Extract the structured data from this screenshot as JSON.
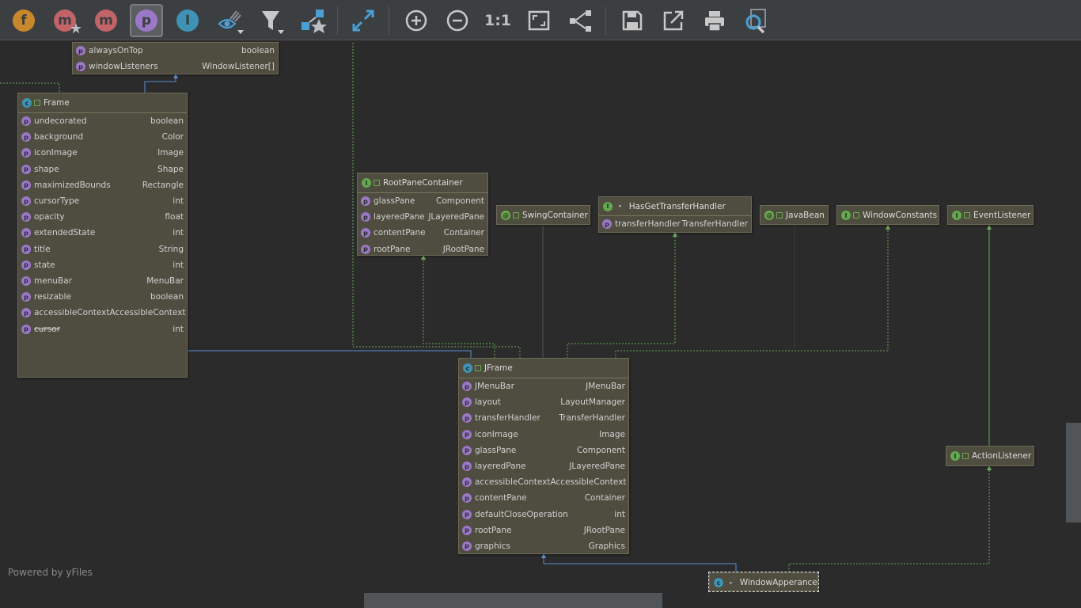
{
  "toolbar": {
    "buttons": [
      {
        "name": "fields-button",
        "glyph": "f",
        "color": "#c8872b",
        "active": false
      },
      {
        "name": "methods-starred-button",
        "glyph": "m",
        "color": "#c26368",
        "active": false,
        "star": true
      },
      {
        "name": "methods-button",
        "glyph": "m",
        "color": "#c26368",
        "active": false
      },
      {
        "name": "properties-button",
        "glyph": "p",
        "color": "#9a78c7",
        "active": true
      },
      {
        "name": "inner-classes-button",
        "glyph": "I",
        "color": "#3e93b5",
        "active": false
      }
    ],
    "zoom_actual_label": "1:1"
  },
  "watermark": "Powered by yFiles",
  "nodes": {
    "window_props": {
      "rows": [
        {
          "name": "alwaysOnTop",
          "type": "boolean"
        },
        {
          "name": "windowListeners",
          "type": "WindowListener[]"
        }
      ]
    },
    "frame": {
      "title": "Frame",
      "rows": [
        {
          "name": "undecorated",
          "type": "boolean"
        },
        {
          "name": "background",
          "type": "Color"
        },
        {
          "name": "iconImage",
          "type": "Image"
        },
        {
          "name": "shape",
          "type": "Shape"
        },
        {
          "name": "maximizedBounds",
          "type": "Rectangle"
        },
        {
          "name": "cursorType",
          "type": "int"
        },
        {
          "name": "opacity",
          "type": "float"
        },
        {
          "name": "extendedState",
          "type": "int"
        },
        {
          "name": "title",
          "type": "String"
        },
        {
          "name": "state",
          "type": "int"
        },
        {
          "name": "menuBar",
          "type": "MenuBar"
        },
        {
          "name": "resizable",
          "type": "boolean"
        },
        {
          "name": "accessibleContext",
          "type": "AccessibleContext"
        },
        {
          "name": "cursor",
          "type": "int"
        }
      ]
    },
    "root_pane_container": {
      "title": "RootPaneContainer",
      "rows": [
        {
          "name": "glassPane",
          "type": "Component"
        },
        {
          "name": "layeredPane",
          "type": "JLayeredPane"
        },
        {
          "name": "contentPane",
          "type": "Container"
        },
        {
          "name": "rootPane",
          "type": "JRootPane"
        }
      ]
    },
    "swing_container": {
      "title": "SwingContainer"
    },
    "has_get_transfer_handler": {
      "title": "HasGetTransferHandler",
      "rows": [
        {
          "name": "transferHandler",
          "type": "TransferHandler"
        }
      ]
    },
    "java_bean": {
      "title": "JavaBean"
    },
    "window_constants": {
      "title": "WindowConstants"
    },
    "event_listener": {
      "title": "EventListener"
    },
    "jframe": {
      "title": "JFrame",
      "rows": [
        {
          "name": "JMenuBar",
          "type": "JMenuBar"
        },
        {
          "name": "layout",
          "type": "LayoutManager"
        },
        {
          "name": "transferHandler",
          "type": "TransferHandler"
        },
        {
          "name": "iconImage",
          "type": "Image"
        },
        {
          "name": "glassPane",
          "type": "Component"
        },
        {
          "name": "layeredPane",
          "type": "JLayeredPane"
        },
        {
          "name": "accessibleContext",
          "type": "AccessibleContext"
        },
        {
          "name": "contentPane",
          "type": "Container"
        },
        {
          "name": "defaultCloseOperation",
          "type": "int"
        },
        {
          "name": "rootPane",
          "type": "JRootPane"
        },
        {
          "name": "graphics",
          "type": "Graphics"
        }
      ]
    },
    "action_listener": {
      "title": "ActionListener"
    },
    "window_apperance": {
      "title": "WindowApperance"
    }
  },
  "colors": {
    "background": "#2b2b2b",
    "toolbar": "#3c3f41",
    "node_fill": "#4f4d40",
    "class_icon": "#3e93b5",
    "interface_icon": "#62a94d",
    "property_icon": "#9a78c7",
    "extends_edge": "#5b8fd0",
    "implements_edge": "#6aa85a"
  }
}
